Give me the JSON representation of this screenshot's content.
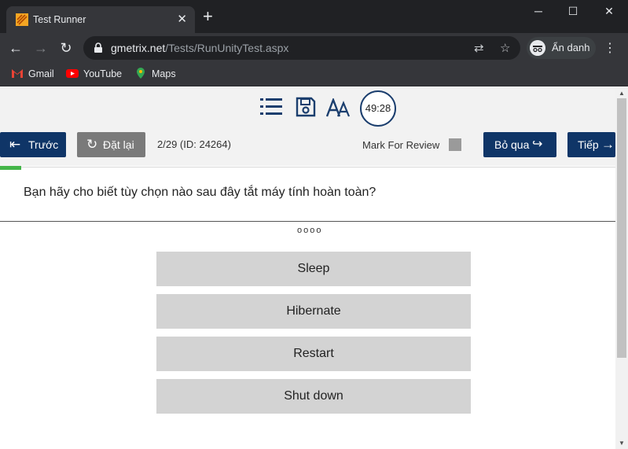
{
  "browser": {
    "tab_title": "Test Runner",
    "url_host": "gmetrix.net",
    "url_path": "/Tests/RunUnityTest.aspx",
    "profile_label": "Ẩn danh",
    "bookmarks": [
      {
        "label": "Gmail",
        "icon": "gmail-icon"
      },
      {
        "label": "YouTube",
        "icon": "youtube-icon"
      },
      {
        "label": "Maps",
        "icon": "maps-icon"
      }
    ]
  },
  "test": {
    "timer": "49:28",
    "prev_label": "Trước",
    "reset_label": "Đặt lại",
    "question_count": "2/29 (ID: 24264)",
    "mark_review_label": "Mark For Review",
    "skip_label": "Bỏ qua",
    "next_label": "Tiếp",
    "question_text": "Bạn hãy cho biết tùy chọn nào sau đây tắt máy tính hoàn toàn?",
    "dots": "oooo",
    "progress_fraction": 0.034,
    "options": [
      "Sleep",
      "Hibernate",
      "Restart",
      "Shut down"
    ]
  },
  "colors": {
    "primary": "#0f3567",
    "progress": "#44b549",
    "chrome_dark": "#202124"
  }
}
